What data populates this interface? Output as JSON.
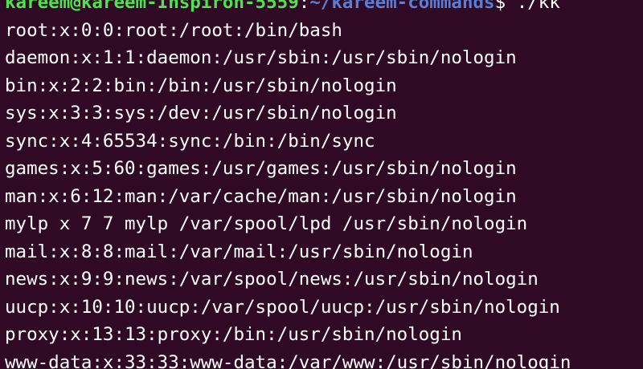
{
  "terminal": {
    "prompt": {
      "user_host": "kareem@kareem-Inspiron-5559",
      "separator": ":",
      "cwd": "~/kareem-commands",
      "symbol": "$ ",
      "command": "./kk"
    },
    "output": [
      "root:x:0:0:root:/root:/bin/bash",
      "daemon:x:1:1:daemon:/usr/sbin:/usr/sbin/nologin",
      "bin:x:2:2:bin:/bin:/usr/sbin/nologin",
      "sys:x:3:3:sys:/dev:/usr/sbin/nologin",
      "sync:x:4:65534:sync:/bin:/bin/sync",
      "games:x:5:60:games:/usr/games:/usr/sbin/nologin",
      "man:x:6:12:man:/var/cache/man:/usr/sbin/nologin",
      "mylp x 7 7 mylp /var/spool/lpd /usr/sbin/nologin",
      "mail:x:8:8:mail:/var/mail:/usr/sbin/nologin",
      "news:x:9:9:news:/var/spool/news:/usr/sbin/nologin",
      "uucp:x:10:10:uucp:/var/spool/uucp:/usr/sbin/nologin",
      "proxy:x:13:13:proxy:/bin:/usr/sbin/nologin",
      "www-data:x:33:33:www-data:/var/www:/usr/sbin/nologin"
    ],
    "colors": {
      "background": "#300a24",
      "text": "#ffffff",
      "user_host": "#4ee44e",
      "cwd": "#5b7fd6"
    }
  }
}
